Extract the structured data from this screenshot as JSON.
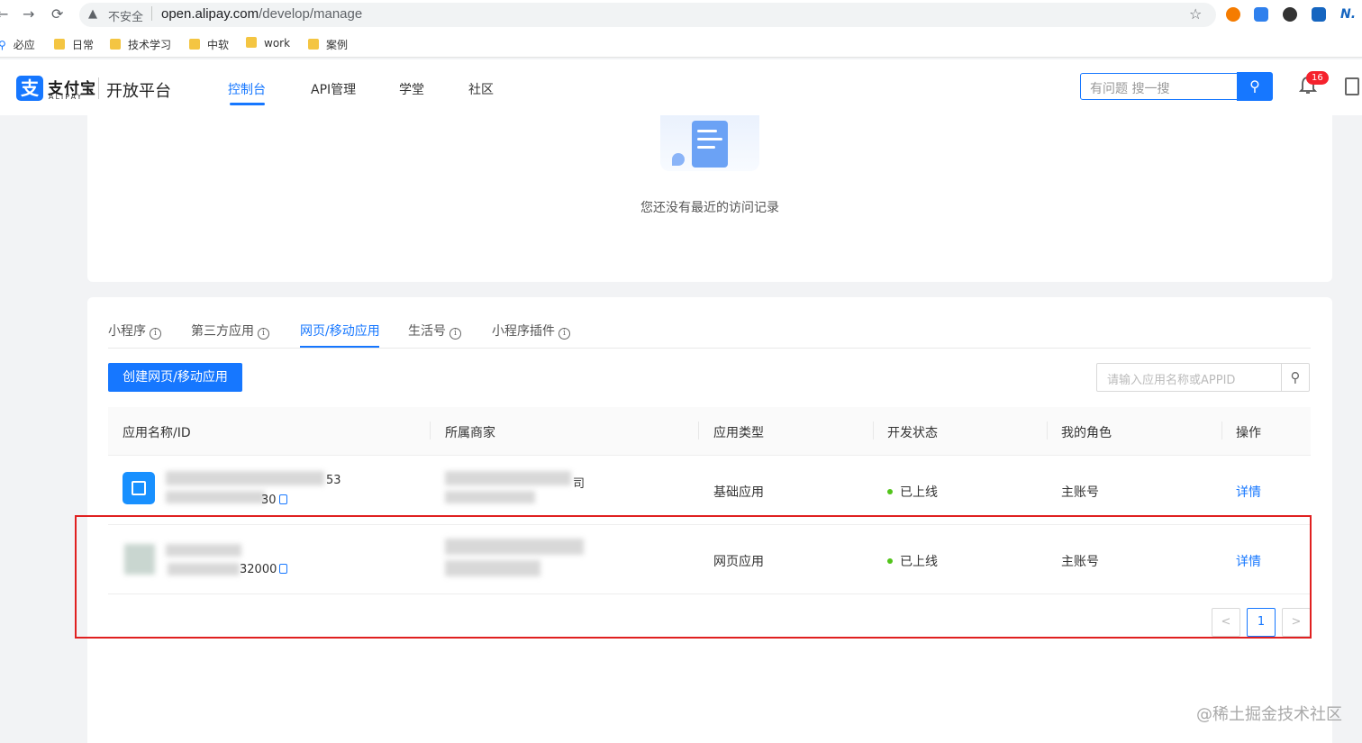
{
  "browser": {
    "back_icon": "←",
    "forward_icon": "→",
    "reload_icon": "⟳",
    "warning_icon": "▲",
    "insecure_label": "不安全",
    "url_host": "open.alipay.com",
    "url_path": "/develop/manage",
    "star_icon": "☆",
    "bookmarks": [
      "必应",
      "日常",
      "技术学习",
      "中软",
      "work",
      "案例"
    ]
  },
  "header": {
    "logo_icon": "支",
    "logo_cn": "支付宝",
    "logo_en": "ALIPAY",
    "platform": "开放平台",
    "nav": [
      "控制台",
      "API管理",
      "学堂",
      "社区"
    ],
    "active_nav": "控制台",
    "search_placeholder": "有问题 搜一搜",
    "search_icon": "⚲",
    "bell_icon": "🔔",
    "notification_count": "16"
  },
  "recent": {
    "empty_text": "您还没有最近的访问记录"
  },
  "apps": {
    "tabs": [
      {
        "label": "小程序",
        "info": true
      },
      {
        "label": "第三方应用",
        "info": true
      },
      {
        "label": "网页/移动应用",
        "info": false
      },
      {
        "label": "生活号",
        "info": true
      },
      {
        "label": "小程序插件",
        "info": true
      }
    ],
    "active_tab": "网页/移动应用",
    "info_icon": "i",
    "create_button": "创建网页/移动应用",
    "search_placeholder": "请输入应用名称或APPID",
    "search_icon": "⚲",
    "columns": [
      "应用名称/ID",
      "所属商家",
      "应用类型",
      "开发状态",
      "我的角色",
      "操作"
    ],
    "rows": [
      {
        "id_fragment_1": "53",
        "id_fragment_2": "30",
        "merchant_fragment": "司",
        "type": "基础应用",
        "status": "已上线",
        "role": "主账号",
        "action": "详情"
      },
      {
        "id_fragment_1": "",
        "id_fragment_2": "32000",
        "merchant_fragment": "",
        "type": "网页应用",
        "status": "已上线",
        "role": "主账号",
        "action": "详情"
      }
    ],
    "pagination": {
      "prev": "<",
      "current": "1",
      "next": ">"
    }
  },
  "watermark": "@稀土掘金技术社区",
  "colors": {
    "accent": "#1677ff",
    "online": "#52c41a",
    "highlight_box": "#e02020"
  }
}
